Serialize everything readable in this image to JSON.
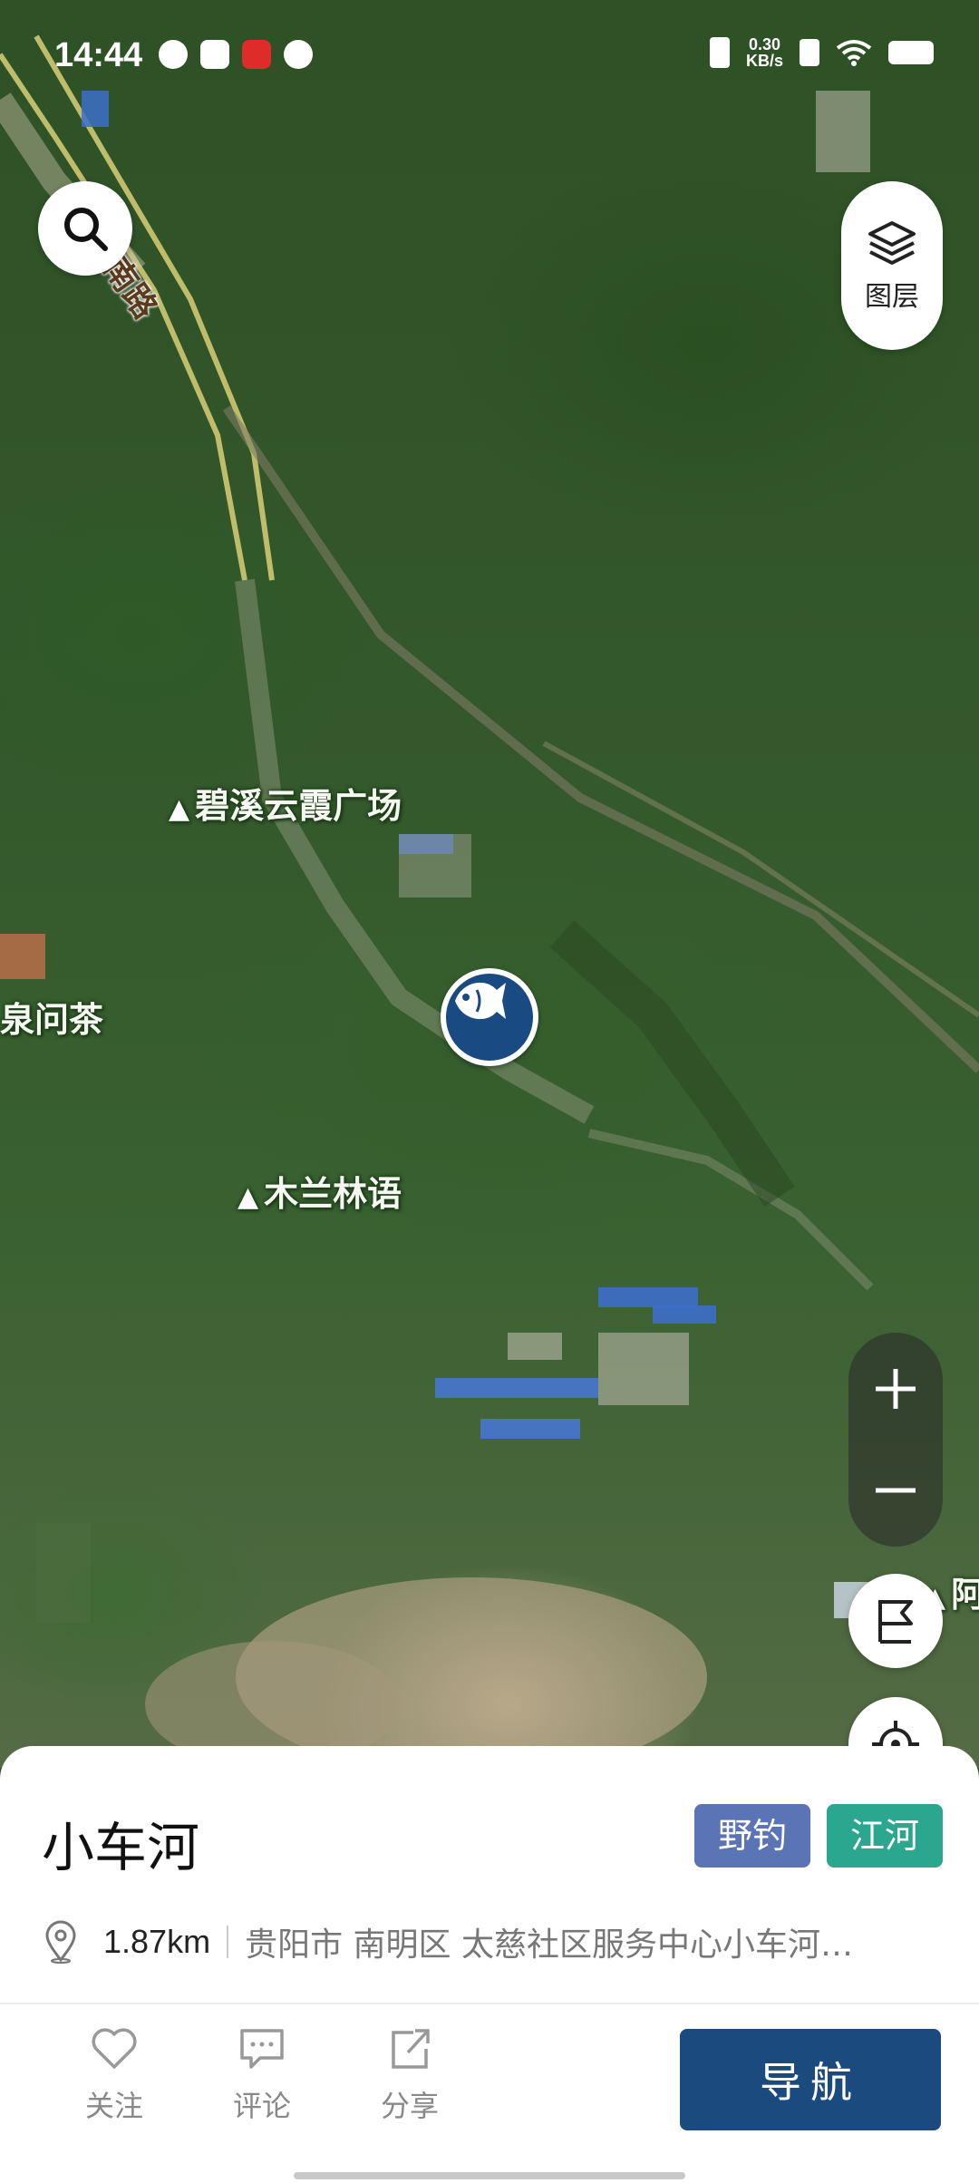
{
  "status_bar": {
    "time": "14:44",
    "net_speed": "0.30",
    "net_unit": "KB/s"
  },
  "map": {
    "layer_button_label": "图层",
    "labels": {
      "plaza": "碧溪云霞广场",
      "forest": "木兰林语",
      "teahouse": "泉问茶",
      "road": "南路",
      "right_edge": "阿"
    },
    "icons": {
      "search": "search-icon",
      "layers": "layers-icon",
      "zoom_in": "plus-icon",
      "zoom_out": "minus-icon",
      "flag": "flag-icon",
      "locate": "locate-icon",
      "marker": "fish-icon"
    },
    "colors": {
      "marker_fill": "#1a4a82"
    }
  },
  "place": {
    "name": "小车河",
    "tags": [
      {
        "label": "野钓",
        "color": "#5a74b5"
      },
      {
        "label": "江河",
        "color": "#2aa78e"
      }
    ],
    "distance": "1.87km",
    "address": "贵阳市 南明区 太慈社区服务中心小车河…"
  },
  "actions": {
    "follow": "关注",
    "comment": "评论",
    "share": "分享",
    "navigate": "导航"
  },
  "colors": {
    "nav_button": "#1b4a7e"
  }
}
